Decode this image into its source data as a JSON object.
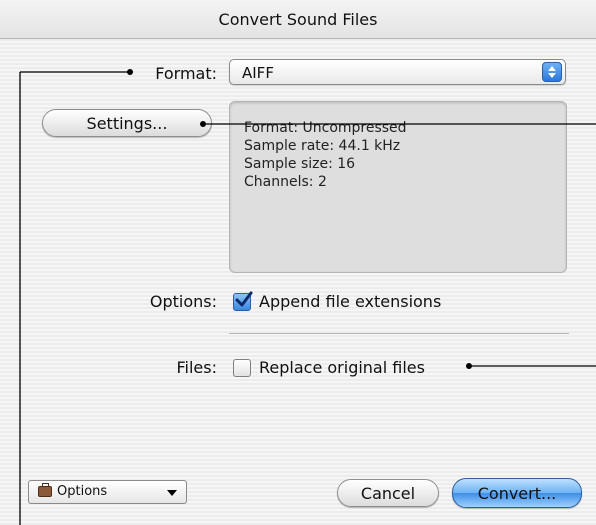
{
  "window": {
    "title": "Convert Sound Files"
  },
  "format": {
    "label": "Format:",
    "selected": "AIFF"
  },
  "settings_button": {
    "label": "Settings..."
  },
  "info_lines": [
    "Format: Uncompressed",
    "Sample rate: 44.1 kHz",
    "Sample size: 16",
    "Channels: 2"
  ],
  "options": {
    "label": "Options:",
    "checkbox_label": "Append file extensions",
    "checked": true
  },
  "files": {
    "label": "Files:",
    "checkbox_label": "Replace original files",
    "checked": false
  },
  "bottom": {
    "options_popup_label": "Options",
    "cancel_label": "Cancel",
    "convert_label": "Convert..."
  },
  "colors": {
    "accent": "#3e8ee6",
    "panel": "#dedede"
  },
  "icons": {
    "stepper": "popup-stepper-icon",
    "briefcase": "briefcase-icon",
    "checkmark": "checkmark-icon"
  }
}
